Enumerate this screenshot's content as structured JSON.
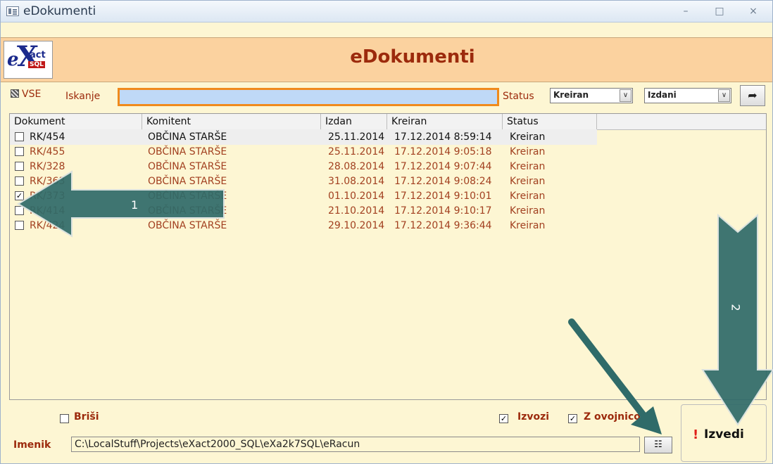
{
  "window": {
    "title": "eDokumenti",
    "controls": [
      "–",
      "□",
      "×"
    ]
  },
  "header": {
    "title": "eDokumenti",
    "logo": {
      "e": "e",
      "x": "X",
      "act": "act",
      "sql": "SQL"
    }
  },
  "filter": {
    "vse_label": "VSE",
    "search_label": "Iskanje",
    "search_value": "",
    "status_label": "Status",
    "status_value": "Kreiran",
    "type_value": "Izdani"
  },
  "list": {
    "columns": [
      "Dokument",
      "Komitent",
      "Izdan",
      "Kreiran",
      "Status"
    ],
    "rows": [
      {
        "checked": false,
        "dokument": "RK/454",
        "komitent": "OBČINA STARŠE",
        "izdan": "25.11.2014",
        "kreiran": "17.12.2014 8:59:14",
        "status": "Kreiran"
      },
      {
        "checked": false,
        "dokument": "RK/455",
        "komitent": "OBČINA STARŠE",
        "izdan": "25.11.2014",
        "kreiran": "17.12.2014 9:05:18",
        "status": "Kreiran"
      },
      {
        "checked": false,
        "dokument": "RK/328",
        "komitent": "OBČINA STARŠE",
        "izdan": "28.08.2014",
        "kreiran": "17.12.2014 9:07:44",
        "status": "Kreiran"
      },
      {
        "checked": false,
        "dokument": "RK/363",
        "komitent": "OBČINA STARŠE",
        "izdan": "31.08.2014",
        "kreiran": "17.12.2014 9:08:24",
        "status": "Kreiran"
      },
      {
        "checked": true,
        "dokument": "RK/373",
        "komitent": "OBČINA STARŠE",
        "izdan": "01.10.2014",
        "kreiran": "17.12.2014 9:10:01",
        "status": "Kreiran"
      },
      {
        "checked": false,
        "dokument": "RK/414",
        "komitent": "OBČINA STARŠE",
        "izdan": "21.10.2014",
        "kreiran": "17.12.2014 9:10:17",
        "status": "Kreiran"
      },
      {
        "checked": false,
        "dokument": "RK/424",
        "komitent": "OBČINA STARŠE",
        "izdan": "29.10.2014",
        "kreiran": "17.12.2014 9:36:44",
        "status": "Kreiran"
      }
    ]
  },
  "bottom": {
    "brisi_label": "Briši",
    "brisi_checked": false,
    "izvozi_label": "Izvozi",
    "izvozi_checked": true,
    "ovojnico_label": "Z ovojnico",
    "ovojnico_checked": true,
    "imenik_label": "Imenik",
    "path": "C:\\LocalStuff\\Projects\\eXact2000_SQL\\eXa2k7SQL\\eRacun",
    "izvedi_label": "Izvedi",
    "izvedi_mark": "!"
  },
  "annotations": {
    "arrow1_label": "1",
    "arrow2_label": "2",
    "color": "#2f6b69"
  },
  "colors": {
    "header_bg": "#fbd29f",
    "form_bg": "#fdf6d3",
    "accent_text": "#9c2a0c",
    "search_border": "#f08a1c",
    "search_bg": "#bfd9f7"
  }
}
